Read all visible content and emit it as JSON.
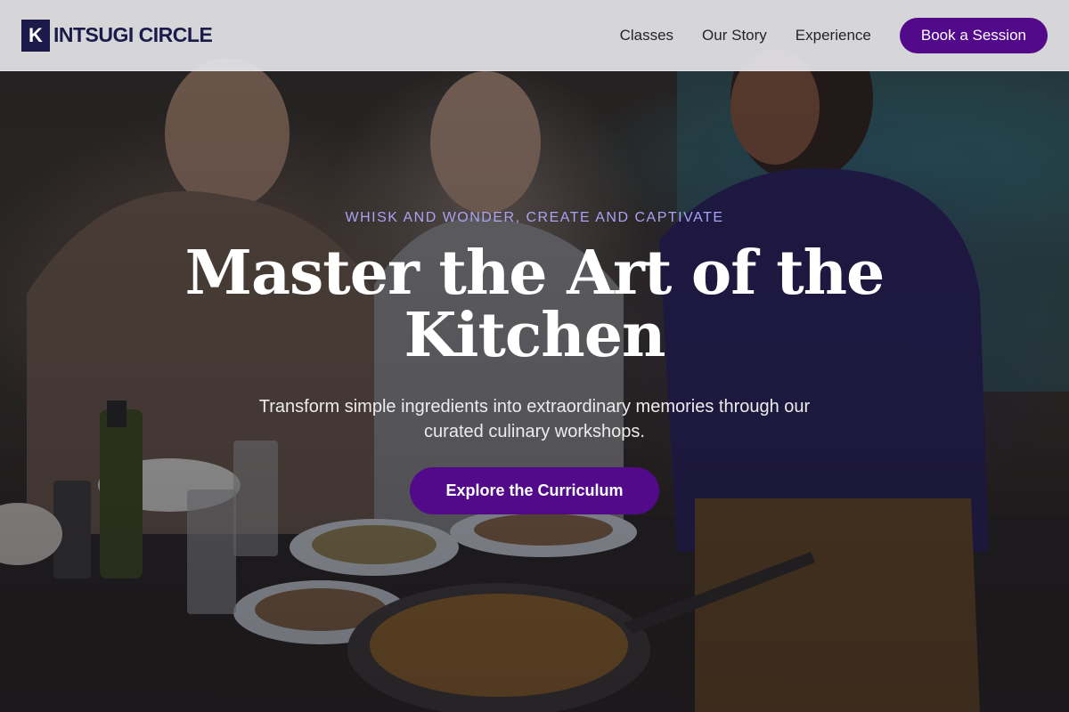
{
  "header": {
    "logo_mark": "K",
    "logo_text": "INTSUGI CIRCLE",
    "nav": {
      "classes": "Classes",
      "our_story": "Our Story",
      "experience": "Experience"
    },
    "book_label": "Book a Session"
  },
  "hero": {
    "eyebrow": "WHISK AND WONDER, CREATE AND CAPTIVATE",
    "headline": "Master the Art of the Kitchen",
    "subtitle": "Transform simple ingredients into extraordinary memories through our curated culinary workshops.",
    "cta_label": "Explore the Curriculum",
    "background_image": "people-cooking-together-photo"
  },
  "colors": {
    "brand_dark": "#1c1a4a",
    "accent": "#520a8a",
    "eyebrow": "#a9a3f2"
  }
}
